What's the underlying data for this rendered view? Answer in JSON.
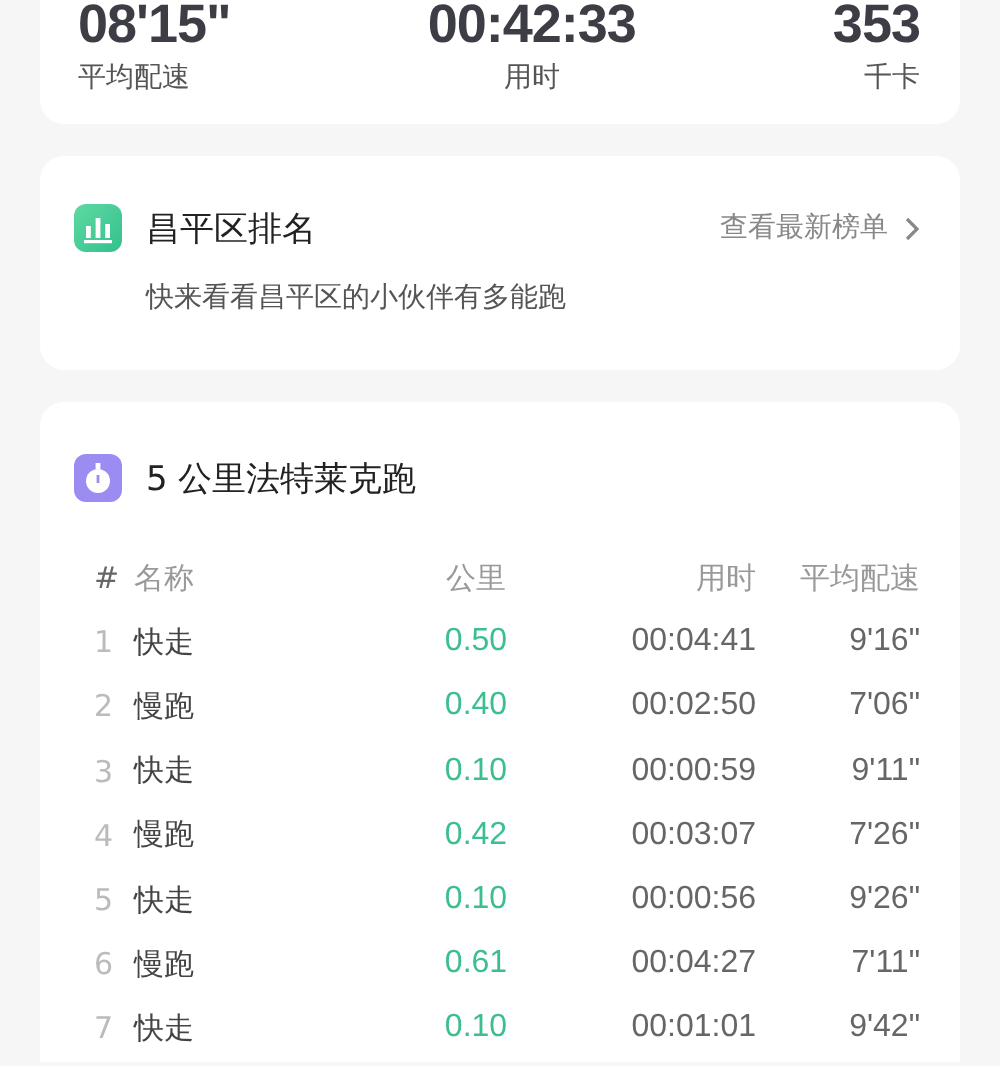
{
  "summary": {
    "stats": [
      {
        "value": "08'15\"",
        "label": "平均配速"
      },
      {
        "value": "00:42:33",
        "label": "用时"
      },
      {
        "value": "353",
        "label": "千卡"
      }
    ]
  },
  "ranking": {
    "title": "昌平区排名",
    "link": "查看最新榜单",
    "description": "快来看看昌平区的小伙伴有多能跑"
  },
  "intervals": {
    "title": "5 公里法特莱克跑",
    "columns": [
      "#",
      "名称",
      "公里",
      "用时",
      "平均配速"
    ],
    "rows": [
      [
        "1",
        "快走",
        "0.50",
        "00:04:41",
        "9'16\""
      ],
      [
        "2",
        "慢跑",
        "0.40",
        "00:02:50",
        "7'06\""
      ],
      [
        "3",
        "快走",
        "0.10",
        "00:00:59",
        "9'11\""
      ],
      [
        "4",
        "慢跑",
        "0.42",
        "00:03:07",
        "7'26\""
      ],
      [
        "5",
        "快走",
        "0.10",
        "00:00:56",
        "9'26\""
      ],
      [
        "6",
        "慢跑",
        "0.61",
        "00:04:27",
        "7'11\""
      ],
      [
        "7",
        "快走",
        "0.10",
        "00:01:01",
        "9'42\""
      ]
    ]
  }
}
